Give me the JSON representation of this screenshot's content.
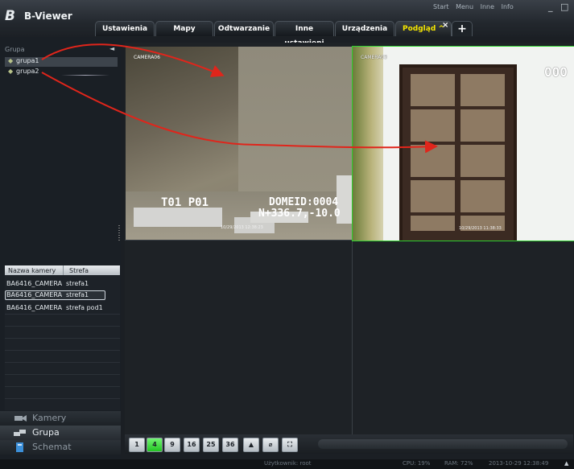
{
  "app": {
    "title": "B-Viewer",
    "logo_glyph": "B"
  },
  "top_menu": [
    "Start",
    "Menu",
    "Inne",
    "Info"
  ],
  "window_controls": {
    "minimize": "_",
    "maximize": "□",
    "close": "✕"
  },
  "tabs": [
    {
      "label": "Ustawienia"
    },
    {
      "label": "Mapy"
    },
    {
      "label": "Odtwarzanie"
    },
    {
      "label": "Inne ustawieni"
    },
    {
      "label": "Urządzenia"
    },
    {
      "label": "Podgląd ^",
      "active": true
    }
  ],
  "tab_close": "×",
  "tab_add": "+",
  "group_panel": {
    "header": "Grupa",
    "collapse": "◄",
    "items": [
      {
        "label": "grupa1"
      },
      {
        "label": "grupa2"
      }
    ]
  },
  "camera_table": {
    "columns": [
      "Nazwa kamery",
      "Strefa"
    ],
    "rows": [
      {
        "name": "BA6416_CAMERA",
        "zone": "strefa1"
      },
      {
        "name": "BA6416_CAMERA",
        "zone": "strefa1"
      },
      {
        "name": "BA6416_CAMERA",
        "zone": "strefa pod1"
      }
    ]
  },
  "nav_buttons": [
    {
      "label": "Kamery"
    },
    {
      "label": "Grupa"
    },
    {
      "label": "Schemat"
    }
  ],
  "video": {
    "cam1": {
      "label": "CAMERA06",
      "osd_left": "T01 P01",
      "osd_id": "DOMEID:0004",
      "osd_coords": "N+336.7,-10.0",
      "timestamp": "10/29/2013 12:38:23"
    },
    "cam2": {
      "label": "CAMERA03",
      "osd_number": "000",
      "timestamp": "10/29/2013 11:38:33"
    }
  },
  "layout_buttons": [
    "1",
    "4",
    "9",
    "16",
    "25",
    "36",
    "▲",
    "⌀",
    "⛶"
  ],
  "status": {
    "user": "Użytkownik: root",
    "cpu": "CPU: 19%",
    "ram": "RAM: 72%",
    "datetime": "2013-10-29 12:38:49",
    "arrow": "▲"
  },
  "colors": {
    "active_tab_text": "#f5e600",
    "selected_layout": "#23c423",
    "camera_border": "#2fd02f",
    "annotation_arrow": "#e0251b"
  }
}
